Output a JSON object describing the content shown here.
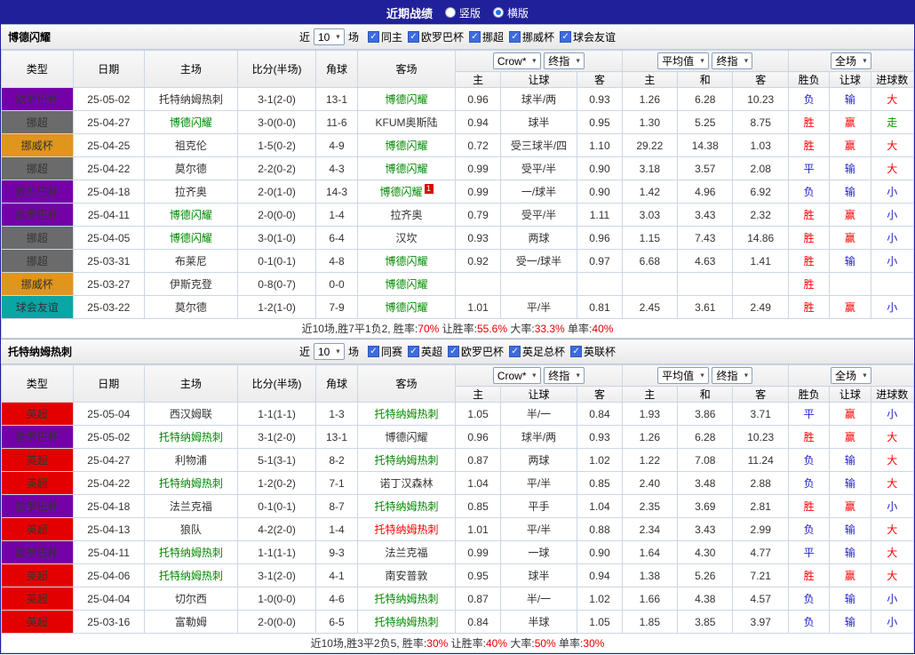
{
  "topbar": {
    "title": "近期战绩",
    "vertical_label": "竖版",
    "horizontal_label": "横版"
  },
  "columns": {
    "type": "类型",
    "date": "日期",
    "home": "主场",
    "score": "比分(半场)",
    "corner": "角球",
    "away": "客场",
    "asia_select1": "Crow*",
    "asia_select2": "终指",
    "euro_select1": "平均值",
    "euro_select2": "终指",
    "result_select": "全场",
    "asia_home": "主",
    "asia_handicap": "让球",
    "asia_away": "客",
    "euro_home": "主",
    "euro_draw": "和",
    "euro_away": "客",
    "result_wdl": "胜负",
    "result_handicap": "让球",
    "result_goals": "进球数"
  },
  "icons": {
    "radio_unchecked": "radio-unchecked-icon",
    "radio_checked": "radio-checked-icon",
    "checkbox_check": "✓",
    "select_arrow": "▼"
  },
  "league_colors": {
    "欧罗巴杯": "#7400A8",
    "挪超": "#6B6B6B",
    "挪威杯": "#E0951C",
    "球会友谊": "#0AA5A5",
    "英超": "#E30000"
  },
  "result_colors": {
    "胜": "#FF0000",
    "赢": "#FF0000",
    "大": "#FF0000",
    "负": "#2222CC",
    "输": "#2222CC",
    "平": "#2222CC",
    "小": "#2222CC",
    "走": "#009900"
  },
  "sections": [
    {
      "team": "博德闪耀",
      "filter": {
        "pre": "近",
        "count": "10",
        "post": "场",
        "checks": [
          {
            "label": "同主",
            "checked": true
          },
          {
            "label": "欧罗巴杯",
            "checked": true
          },
          {
            "label": "挪超",
            "checked": true
          },
          {
            "label": "挪威杯",
            "checked": true
          },
          {
            "label": "球会友谊",
            "checked": true
          }
        ]
      },
      "rows": [
        {
          "league": "欧罗巴杯",
          "date": "25-05-02",
          "home": "托特纳姆热刺",
          "home_c": "",
          "score": "3-1(2-0)",
          "corner": "13-1",
          "away": "博德闪耀",
          "away_c": "g",
          "badge": "",
          "asia": [
            "0.96",
            "球半/两",
            "0.93"
          ],
          "euro": [
            "1.26",
            "6.28",
            "10.23"
          ],
          "res": [
            "负",
            "输",
            "大"
          ]
        },
        {
          "league": "挪超",
          "date": "25-04-27",
          "home": "博德闪耀",
          "home_c": "g",
          "score": "3-0(0-0)",
          "corner": "11-6",
          "away": "KFUM奥斯陆",
          "away_c": "",
          "badge": "",
          "asia": [
            "0.94",
            "球半",
            "0.95"
          ],
          "euro": [
            "1.30",
            "5.25",
            "8.75"
          ],
          "res": [
            "胜",
            "赢",
            "走"
          ]
        },
        {
          "league": "挪威杯",
          "date": "25-04-25",
          "home": "祖克伦",
          "home_c": "",
          "score": "1-5(0-2)",
          "corner": "4-9",
          "away": "博德闪耀",
          "away_c": "g",
          "badge": "",
          "asia": [
            "0.72",
            "受三球半/四",
            "1.10"
          ],
          "euro": [
            "29.22",
            "14.38",
            "1.03"
          ],
          "res": [
            "胜",
            "赢",
            "大"
          ]
        },
        {
          "league": "挪超",
          "date": "25-04-22",
          "home": "莫尔德",
          "home_c": "",
          "score": "2-2(0-2)",
          "corner": "4-3",
          "away": "博德闪耀",
          "away_c": "g",
          "badge": "",
          "asia": [
            "0.99",
            "受平/半",
            "0.90"
          ],
          "euro": [
            "3.18",
            "3.57",
            "2.08"
          ],
          "res": [
            "平",
            "输",
            "大"
          ]
        },
        {
          "league": "欧罗巴杯",
          "date": "25-04-18",
          "home": "拉齐奥",
          "home_c": "",
          "score": "2-0(1-0)",
          "corner": "14-3",
          "away": "博德闪耀",
          "away_c": "g",
          "badge": "1",
          "asia": [
            "0.99",
            "一/球半",
            "0.90"
          ],
          "euro": [
            "1.42",
            "4.96",
            "6.92"
          ],
          "res": [
            "负",
            "输",
            "小"
          ]
        },
        {
          "league": "欧罗巴杯",
          "date": "25-04-11",
          "home": "博德闪耀",
          "home_c": "g",
          "score": "2-0(0-0)",
          "corner": "1-4",
          "away": "拉齐奥",
          "away_c": "",
          "badge": "",
          "asia": [
            "0.79",
            "受平/半",
            "1.11"
          ],
          "euro": [
            "3.03",
            "3.43",
            "2.32"
          ],
          "res": [
            "胜",
            "赢",
            "小"
          ]
        },
        {
          "league": "挪超",
          "date": "25-04-05",
          "home": "博德闪耀",
          "home_c": "g",
          "score": "3-0(1-0)",
          "corner": "6-4",
          "away": "汉坎",
          "away_c": "",
          "badge": "",
          "asia": [
            "0.93",
            "两球",
            "0.96"
          ],
          "euro": [
            "1.15",
            "7.43",
            "14.86"
          ],
          "res": [
            "胜",
            "赢",
            "小"
          ]
        },
        {
          "league": "挪超",
          "date": "25-03-31",
          "home": "布莱尼",
          "home_c": "",
          "score": "0-1(0-1)",
          "corner": "4-8",
          "away": "博德闪耀",
          "away_c": "g",
          "badge": "",
          "asia": [
            "0.92",
            "受一/球半",
            "0.97"
          ],
          "euro": [
            "6.68",
            "4.63",
            "1.41"
          ],
          "res": [
            "胜",
            "输",
            "小"
          ]
        },
        {
          "league": "挪威杯",
          "date": "25-03-27",
          "home": "伊斯克登",
          "home_c": "",
          "score": "0-8(0-7)",
          "corner": "0-0",
          "away": "博德闪耀",
          "away_c": "g",
          "badge": "",
          "asia": [
            "",
            "",
            ""
          ],
          "euro": [
            "",
            "",
            ""
          ],
          "res": [
            "胜",
            "",
            ""
          ]
        },
        {
          "league": "球会友谊",
          "date": "25-03-22",
          "home": "莫尔德",
          "home_c": "",
          "score": "1-2(1-0)",
          "corner": "7-9",
          "away": "博德闪耀",
          "away_c": "g",
          "badge": "",
          "asia": [
            "1.01",
            "平/半",
            "0.81"
          ],
          "euro": [
            "2.45",
            "3.61",
            "2.49"
          ],
          "res": [
            "胜",
            "赢",
            "小"
          ]
        }
      ],
      "summary": [
        [
          "近10场,胜7平1负2, 胜率:",
          "d"
        ],
        [
          "70%",
          "r"
        ],
        [
          " 让胜率:",
          "d"
        ],
        [
          "55.6%",
          "r"
        ],
        [
          " 大率:",
          "d"
        ],
        [
          "33.3%",
          "r"
        ],
        [
          " 单率:",
          "d"
        ],
        [
          "40%",
          "r"
        ]
      ]
    },
    {
      "team": "托特纳姆热刺",
      "filter": {
        "pre": "近",
        "count": "10",
        "post": "场",
        "checks": [
          {
            "label": "同赛",
            "checked": true
          },
          {
            "label": "英超",
            "checked": true
          },
          {
            "label": "欧罗巴杯",
            "checked": true
          },
          {
            "label": "英足总杯",
            "checked": true
          },
          {
            "label": "英联杯",
            "checked": true
          }
        ]
      },
      "rows": [
        {
          "league": "英超",
          "date": "25-05-04",
          "home": "西汉姆联",
          "home_c": "",
          "score": "1-1(1-1)",
          "corner": "1-3",
          "away": "托特纳姆热刺",
          "away_c": "g",
          "badge": "",
          "asia": [
            "1.05",
            "半/一",
            "0.84"
          ],
          "euro": [
            "1.93",
            "3.86",
            "3.71"
          ],
          "res": [
            "平",
            "赢",
            "小"
          ]
        },
        {
          "league": "欧罗巴杯",
          "date": "25-05-02",
          "home": "托特纳姆热刺",
          "home_c": "g",
          "score": "3-1(2-0)",
          "corner": "13-1",
          "away": "博德闪耀",
          "away_c": "",
          "badge": "",
          "asia": [
            "0.96",
            "球半/两",
            "0.93"
          ],
          "euro": [
            "1.26",
            "6.28",
            "10.23"
          ],
          "res": [
            "胜",
            "赢",
            "大"
          ]
        },
        {
          "league": "英超",
          "date": "25-04-27",
          "home": "利物浦",
          "home_c": "",
          "score": "5-1(3-1)",
          "corner": "8-2",
          "away": "托特纳姆热刺",
          "away_c": "g",
          "badge": "",
          "asia": [
            "0.87",
            "两球",
            "1.02"
          ],
          "euro": [
            "1.22",
            "7.08",
            "11.24"
          ],
          "res": [
            "负",
            "输",
            "大"
          ]
        },
        {
          "league": "英超",
          "date": "25-04-22",
          "home": "托特纳姆热刺",
          "home_c": "g",
          "score": "1-2(0-2)",
          "corner": "7-1",
          "away": "诺丁汉森林",
          "away_c": "",
          "badge": "",
          "asia": [
            "1.04",
            "平/半",
            "0.85"
          ],
          "euro": [
            "2.40",
            "3.48",
            "2.88"
          ],
          "res": [
            "负",
            "输",
            "大"
          ]
        },
        {
          "league": "欧罗巴杯",
          "date": "25-04-18",
          "home": "法兰克福",
          "home_c": "",
          "score": "0-1(0-1)",
          "corner": "8-7",
          "away": "托特纳姆热刺",
          "away_c": "g",
          "badge": "",
          "asia": [
            "0.85",
            "平手",
            "1.04"
          ],
          "euro": [
            "2.35",
            "3.69",
            "2.81"
          ],
          "res": [
            "胜",
            "赢",
            "小"
          ]
        },
        {
          "league": "英超",
          "date": "25-04-13",
          "home": "狼队",
          "home_c": "",
          "score": "4-2(2-0)",
          "corner": "1-4",
          "away": "托特纳姆热刺",
          "away_c": "r",
          "badge": "",
          "asia": [
            "1.01",
            "平/半",
            "0.88"
          ],
          "euro": [
            "2.34",
            "3.43",
            "2.99"
          ],
          "res": [
            "负",
            "输",
            "大"
          ]
        },
        {
          "league": "欧罗巴杯",
          "date": "25-04-11",
          "home": "托特纳姆热刺",
          "home_c": "g",
          "score": "1-1(1-1)",
          "corner": "9-3",
          "away": "法兰克福",
          "away_c": "",
          "badge": "",
          "asia": [
            "0.99",
            "一球",
            "0.90"
          ],
          "euro": [
            "1.64",
            "4.30",
            "4.77"
          ],
          "res": [
            "平",
            "输",
            "大"
          ]
        },
        {
          "league": "英超",
          "date": "25-04-06",
          "home": "托特纳姆热刺",
          "home_c": "g",
          "score": "3-1(2-0)",
          "corner": "4-1",
          "away": "南安普敦",
          "away_c": "",
          "badge": "",
          "asia": [
            "0.95",
            "球半",
            "0.94"
          ],
          "euro": [
            "1.38",
            "5.26",
            "7.21"
          ],
          "res": [
            "胜",
            "赢",
            "大"
          ]
        },
        {
          "league": "英超",
          "date": "25-04-04",
          "home": "切尔西",
          "home_c": "",
          "score": "1-0(0-0)",
          "corner": "4-6",
          "away": "托特纳姆热刺",
          "away_c": "g",
          "badge": "",
          "asia": [
            "0.87",
            "半/一",
            "1.02"
          ],
          "euro": [
            "1.66",
            "4.38",
            "4.57"
          ],
          "res": [
            "负",
            "输",
            "小"
          ]
        },
        {
          "league": "英超",
          "date": "25-03-16",
          "home": "富勒姆",
          "home_c": "",
          "score": "2-0(0-0)",
          "corner": "6-5",
          "away": "托特纳姆热刺",
          "away_c": "g",
          "badge": "",
          "asia": [
            "0.84",
            "半球",
            "1.05"
          ],
          "euro": [
            "1.85",
            "3.85",
            "3.97"
          ],
          "res": [
            "负",
            "输",
            "小"
          ]
        }
      ],
      "summary": [
        [
          "近10场,胜3平2负5, 胜率:",
          "d"
        ],
        [
          "30%",
          "r"
        ],
        [
          " 让胜率:",
          "d"
        ],
        [
          "40%",
          "r"
        ],
        [
          " 大率:",
          "d"
        ],
        [
          "50%",
          "r"
        ],
        [
          " 单率:",
          "d"
        ],
        [
          "30%",
          "r"
        ]
      ]
    }
  ]
}
